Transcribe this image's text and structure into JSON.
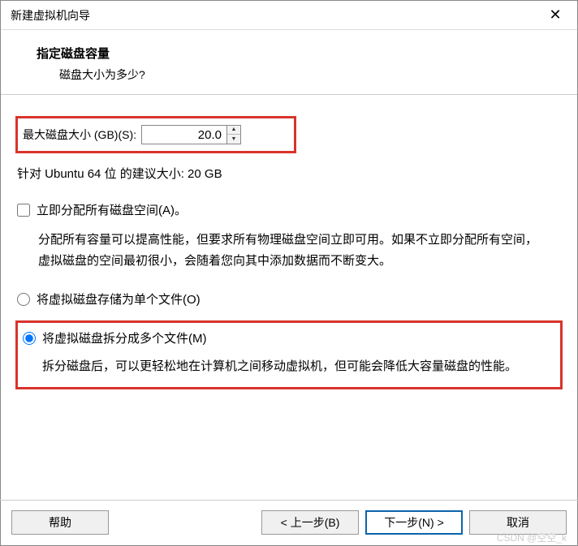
{
  "titlebar": {
    "title": "新建虚拟机向导"
  },
  "header": {
    "title": "指定磁盘容量",
    "subtitle": "磁盘大小为多少?"
  },
  "disk": {
    "max_size_label": "最大磁盘大小 (GB)(S):",
    "max_size_value": "20.0",
    "recommend": "针对 Ubuntu 64 位 的建议大小: 20 GB"
  },
  "allocate": {
    "label": "立即分配所有磁盘空间(A)。",
    "desc": "分配所有容量可以提高性能，但要求所有物理磁盘空间立即可用。如果不立即分配所有空间，虚拟磁盘的空间最初很小，会随着您向其中添加数据而不断变大。"
  },
  "store": {
    "single_label": "将虚拟磁盘存储为单个文件(O)",
    "split_label": "将虚拟磁盘拆分成多个文件(M)",
    "split_desc": "拆分磁盘后，可以更轻松地在计算机之间移动虚拟机，但可能会降低大容量磁盘的性能。"
  },
  "footer": {
    "help": "帮助",
    "back": "< 上一步(B)",
    "next": "下一步(N) >",
    "cancel": "取消"
  },
  "watermark": "CSDN @空空_k"
}
